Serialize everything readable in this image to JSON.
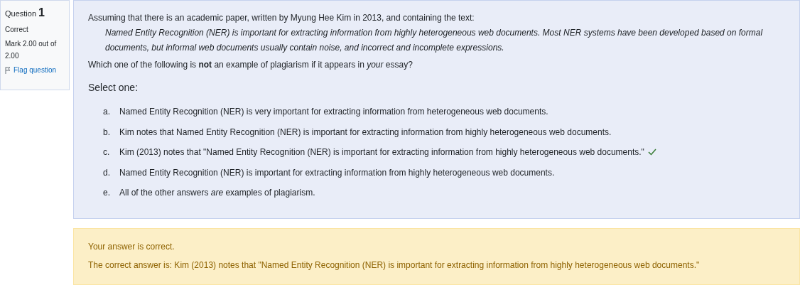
{
  "info": {
    "label": "Question",
    "number": "1",
    "status": "Correct",
    "mark": "Mark 2.00 out of 2.00",
    "flag": "Flag question"
  },
  "question": {
    "intro": "Assuming that there is an academic paper, written by Myung Hee Kim in 2013, and containing the text:",
    "quote": "Named Entity Recognition (NER) is important for extracting information from highly heterogeneous web documents. Most NER systems have been developed based on formal documents, but informal web documents usually contain noise, and incorrect and incomplete expressions.",
    "prompt": "Which one of the following is **not** an example of plagiarism if it appears in *your* essay?",
    "select_label": "Select one:",
    "options": [
      {
        "letter": "a.",
        "text": "Named Entity Recognition (NER) is very important for extracting information from heterogeneous web documents.",
        "marked_correct": false
      },
      {
        "letter": "b.",
        "text": "Kim notes that Named Entity Recognition (NER) is important for extracting information from highly heterogeneous web documents.",
        "marked_correct": false
      },
      {
        "letter": "c.",
        "text": "Kim (2013) notes that \"Named Entity Recognition (NER) is important for extracting information from highly heterogeneous web documents.\"",
        "marked_correct": true
      },
      {
        "letter": "d.",
        "text": "Named Entity Recognition (NER) is important for extracting information from highly heterogeneous web documents.",
        "marked_correct": false
      },
      {
        "letter": "e.",
        "text": "All of the other answers *are* examples of plagiarism.",
        "marked_correct": false
      }
    ]
  },
  "feedback": {
    "result": "Your answer is correct.",
    "correct_answer": "The correct answer is: Kim (2013) notes that \"Named Entity Recognition (NER) is important for extracting information from highly heterogeneous web documents.\""
  }
}
